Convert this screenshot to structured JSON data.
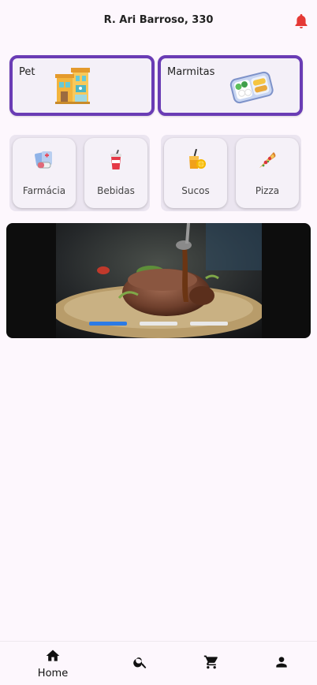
{
  "header": {
    "address": "R. Ari Barroso, 330",
    "notification_icon": "bell-icon",
    "accent": "#e53935"
  },
  "featured": [
    {
      "label": "Pet",
      "icon": "pet-shop-icon"
    },
    {
      "label": "Marmitas",
      "icon": "lunchbox-icon"
    }
  ],
  "categories": [
    {
      "label": "Farmácia",
      "icon": "pharmacy-icon"
    },
    {
      "label": "Bebidas",
      "icon": "soda-cup-icon"
    },
    {
      "label": "Sucos",
      "icon": "juice-icon"
    },
    {
      "label": "Pizza",
      "icon": "pizza-slice-icon"
    }
  ],
  "banner": {
    "active_index": 0,
    "slide_count": 3,
    "indicator_active_color": "#2c7be5",
    "indicator_color": "#e8e8e8"
  },
  "nav": {
    "items": [
      {
        "label": "Home",
        "icon": "home-icon"
      },
      {
        "label": "",
        "icon": "search-icon"
      },
      {
        "label": "",
        "icon": "cart-icon"
      },
      {
        "label": "",
        "icon": "person-icon"
      }
    ]
  },
  "brand_color": "#6a3cb5"
}
